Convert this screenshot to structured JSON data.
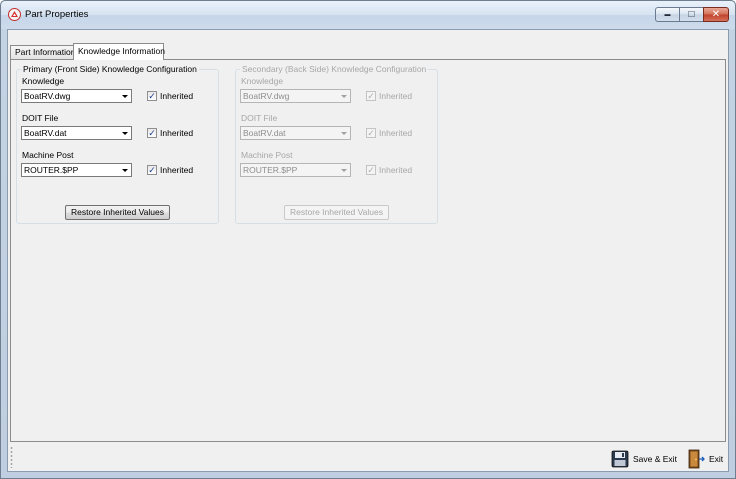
{
  "window": {
    "title": "Part Properties",
    "caption_buttons": {
      "minimize": "▬",
      "maximize": "□",
      "close": "✕"
    }
  },
  "tabs": [
    {
      "label": "Part Information"
    },
    {
      "label": "Knowledge Information"
    }
  ],
  "primary": {
    "legend": "Primary (Front Side) Knowledge Configuration",
    "knowledge_label": "Knowledge",
    "knowledge_value": "BoatRV.dwg",
    "doit_label": "DOIT File",
    "doit_value": "BoatRV.dat",
    "machine_label": "Machine Post",
    "machine_value": "ROUTER.$PP",
    "inherited_label": "Inherited",
    "checkmark": "✓",
    "restore_label": "Restore Inherited Values"
  },
  "secondary": {
    "legend": "Secondary (Back Side) Knowledge Configuration",
    "knowledge_label": "Knowledge",
    "knowledge_value": "BoatRV.dwg",
    "doit_label": "DOIT File",
    "doit_value": "BoatRV.dat",
    "machine_label": "Machine Post",
    "machine_value": "ROUTER.$PP",
    "inherited_label": "Inherited",
    "checkmark": "✓",
    "restore_label": "Restore Inherited Values"
  },
  "footer": {
    "save_exit_label": "Save & Exit",
    "exit_label": "Exit",
    "save_icon": "floppy-disk-icon",
    "exit_icon": "door-exit-icon"
  },
  "colors": {
    "titlebar": "#d7e3f1",
    "client_bg": "#f0f0f0",
    "close_button": "#c0412a",
    "disabled_text": "#a7a7a7",
    "check_color": "#1c3f95"
  }
}
